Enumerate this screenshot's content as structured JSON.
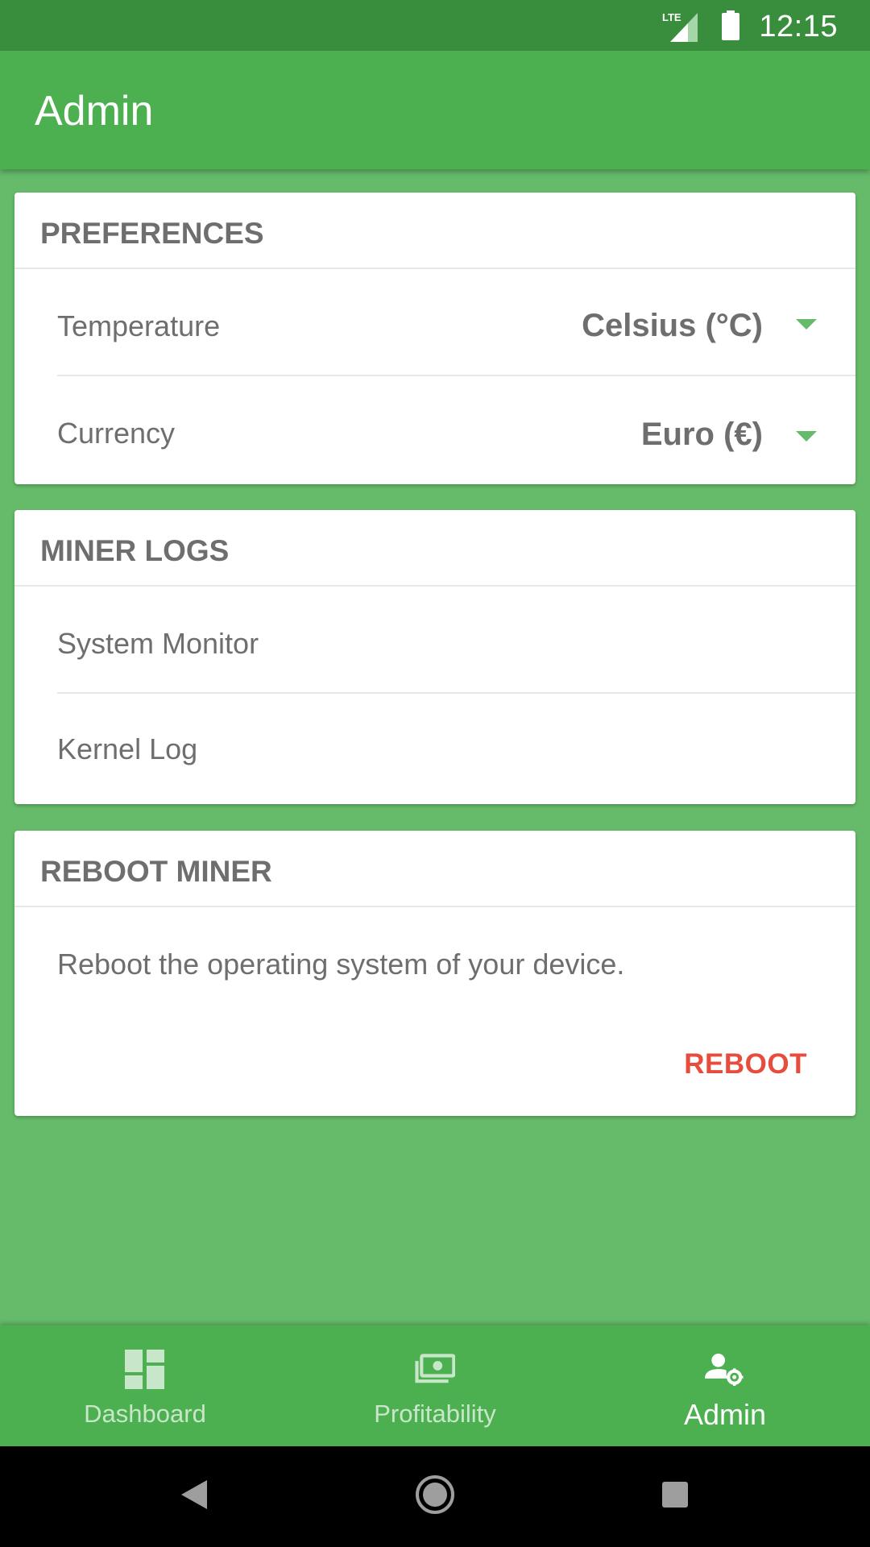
{
  "status_bar": {
    "time": "12:15",
    "network": "LTE"
  },
  "app_bar": {
    "title": "Admin"
  },
  "preferences": {
    "header": "PREFERENCES",
    "rows": [
      {
        "label": "Temperature",
        "value": "Celsius (°C)"
      },
      {
        "label": "Currency",
        "value": "Euro (€)"
      }
    ]
  },
  "miner_logs": {
    "header": "MINER LOGS",
    "items": [
      {
        "label": "System Monitor"
      },
      {
        "label": "Kernel Log"
      }
    ]
  },
  "reboot": {
    "header": "REBOOT MINER",
    "description": "Reboot the operating system of your device.",
    "button_label": "REBOOT"
  },
  "bottom_nav": {
    "items": [
      {
        "label": "Dashboard",
        "icon": "dashboard-icon"
      },
      {
        "label": "Profitability",
        "icon": "money-icon"
      },
      {
        "label": "Admin",
        "icon": "admin-settings-icon",
        "active": true
      }
    ]
  },
  "colors": {
    "primary": "#4caf50",
    "primary_dark": "#388e3c",
    "background": "#66bb6a",
    "danger": "#e74c3c",
    "text_gray": "#6e6e6e"
  }
}
